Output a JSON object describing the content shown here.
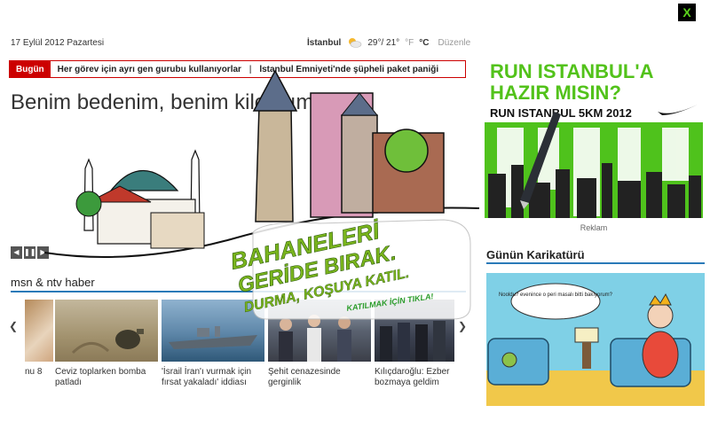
{
  "close_label": "X",
  "date": "17 Eylül 2012 Pazartesi",
  "weather": {
    "city": "İstanbul",
    "temps": "29°/ 21°",
    "unit_f": "°F",
    "unit_c": "°C",
    "edit": "Düzenle",
    "icon": "partly-sunny-icon"
  },
  "ticker": {
    "badge": "Bugün",
    "items": [
      "Her görev için ayrı gen gurubu kullanıyorlar",
      "İstanbul Emniyeti'nde şüpheli paket paniği"
    ],
    "separator": "|"
  },
  "headline": "Benim bedenim, benim kilolarım",
  "slide_controls": [
    "prev-icon",
    "pause-icon",
    "next-icon"
  ],
  "section_title": "msn & ntv haber",
  "news": [
    {
      "caption": "nu 8"
    },
    {
      "caption": "Ceviz toplarken bomba patladı"
    },
    {
      "caption": "'İsrail İran'ı vurmak için fırsat yakaladı' iddiası"
    },
    {
      "caption": "Şehit cenazesinde gerginlik"
    },
    {
      "caption": "Kılıçdaroğlu: Ezber bozmaya geldim"
    }
  ],
  "ad": {
    "line1": "RUN ISTANBUL'A",
    "line2": "HAZIR MISIN?",
    "line3": "RUN ISTANBUL 5KM 2012",
    "caption": "Reklam"
  },
  "cartoon": {
    "title": "Günün Karikatürü",
    "bubble": "Nooldu? evenince o peri masalı bitti bakıyorum?"
  },
  "overlay": {
    "line1": "BAHANELERİ",
    "line2": "GERİDE BIRAK.",
    "line3": "DURMA, KOŞUYA KATIL.",
    "cta": "KATILMAK İÇİN TIKLA!"
  }
}
